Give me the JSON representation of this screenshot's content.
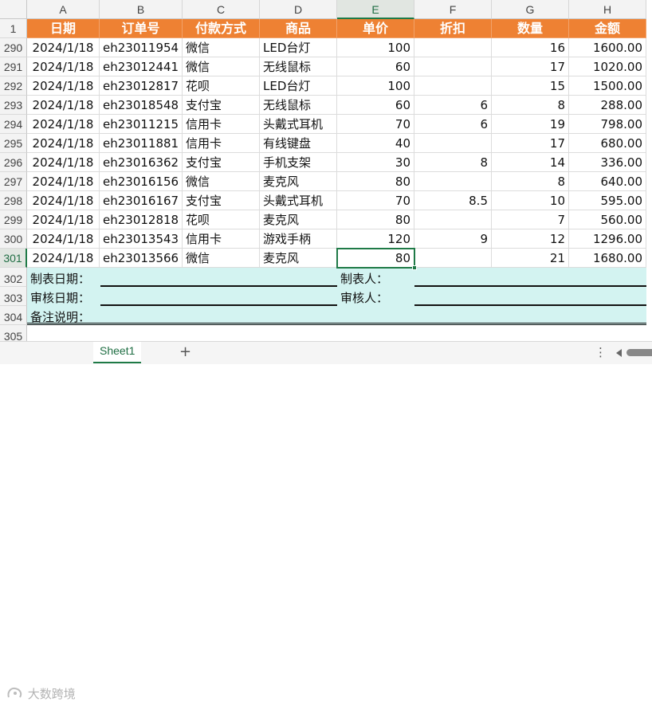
{
  "columns": [
    "A",
    "B",
    "C",
    "D",
    "E",
    "F",
    "G",
    "H"
  ],
  "selected_column": "E",
  "header_row": {
    "row_number": "1",
    "labels": [
      "日期",
      "订单号",
      "付款方式",
      "商品",
      "单价",
      "折扣",
      "数量",
      "金额"
    ]
  },
  "rows": [
    {
      "n": "290",
      "date": "2024/1/18",
      "order": "eh23011954",
      "pay": "微信",
      "item": "LED台灯",
      "price": "100",
      "discount": "",
      "qty": "16",
      "amount": "1600.00"
    },
    {
      "n": "291",
      "date": "2024/1/18",
      "order": "eh23012441",
      "pay": "微信",
      "item": "无线鼠标",
      "price": "60",
      "discount": "",
      "qty": "17",
      "amount": "1020.00"
    },
    {
      "n": "292",
      "date": "2024/1/18",
      "order": "eh23012817",
      "pay": "花呗",
      "item": "LED台灯",
      "price": "100",
      "discount": "",
      "qty": "15",
      "amount": "1500.00"
    },
    {
      "n": "293",
      "date": "2024/1/18",
      "order": "eh23018548",
      "pay": "支付宝",
      "item": "无线鼠标",
      "price": "60",
      "discount": "6",
      "qty": "8",
      "amount": "288.00"
    },
    {
      "n": "294",
      "date": "2024/1/18",
      "order": "eh23011215",
      "pay": "信用卡",
      "item": "头戴式耳机",
      "price": "70",
      "discount": "6",
      "qty": "19",
      "amount": "798.00"
    },
    {
      "n": "295",
      "date": "2024/1/18",
      "order": "eh23011881",
      "pay": "信用卡",
      "item": "有线键盘",
      "price": "40",
      "discount": "",
      "qty": "17",
      "amount": "680.00"
    },
    {
      "n": "296",
      "date": "2024/1/18",
      "order": "eh23016362",
      "pay": "支付宝",
      "item": "手机支架",
      "price": "30",
      "discount": "8",
      "qty": "14",
      "amount": "336.00"
    },
    {
      "n": "297",
      "date": "2024/1/18",
      "order": "eh23016156",
      "pay": "微信",
      "item": "麦克风",
      "price": "80",
      "discount": "",
      "qty": "8",
      "amount": "640.00"
    },
    {
      "n": "298",
      "date": "2024/1/18",
      "order": "eh23016167",
      "pay": "支付宝",
      "item": "头戴式耳机",
      "price": "70",
      "discount": "8.5",
      "qty": "10",
      "amount": "595.00"
    },
    {
      "n": "299",
      "date": "2024/1/18",
      "order": "eh23012818",
      "pay": "花呗",
      "item": "麦克风",
      "price": "80",
      "discount": "",
      "qty": "7",
      "amount": "560.00"
    },
    {
      "n": "300",
      "date": "2024/1/18",
      "order": "eh23013543",
      "pay": "信用卡",
      "item": "游戏手柄",
      "price": "120",
      "discount": "9",
      "qty": "12",
      "amount": "1296.00"
    },
    {
      "n": "301",
      "date": "2024/1/18",
      "order": "eh23013566",
      "pay": "微信",
      "item": "麦克风",
      "price": "80",
      "discount": "",
      "qty": "21",
      "amount": "1680.00"
    }
  ],
  "footer": {
    "row_302": "302",
    "row_303": "303",
    "row_304": "304",
    "row_305": "305",
    "made_date": "制表日期：",
    "made_by": "制表人：",
    "review_date": "审核日期：",
    "reviewer": "审核人：",
    "remark": "备注说明："
  },
  "sheet_tab": "Sheet1",
  "add_sheet": "+",
  "more_menu": "⋮",
  "watermark": "大数跨境",
  "colors": {
    "header_bg": "#ee8133",
    "footer_bg": "#d3f3f1",
    "selection": "#1f7a47"
  }
}
